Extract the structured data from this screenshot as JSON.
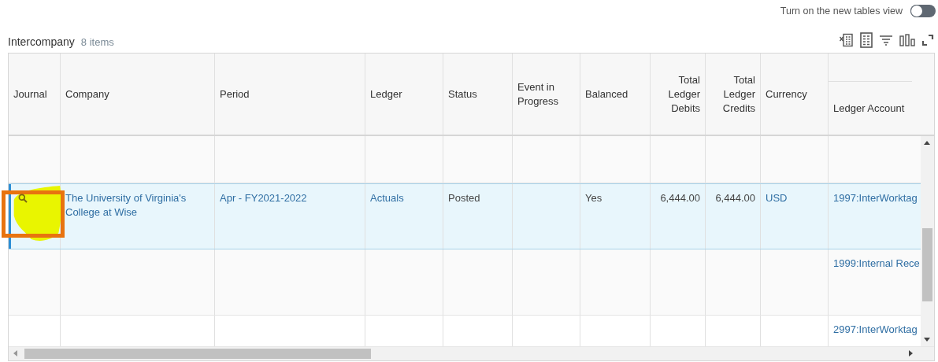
{
  "toggle": {
    "label": "Turn on the new tables view",
    "on": false
  },
  "grid": {
    "title": "Intercompany",
    "count": "8 items",
    "columns": [
      {
        "label": "Journal",
        "numeric": false
      },
      {
        "label": "Company",
        "numeric": false
      },
      {
        "label": "Period",
        "numeric": false
      },
      {
        "label": "Ledger",
        "numeric": false
      },
      {
        "label": "Status",
        "numeric": false
      },
      {
        "label": "Event in Progress",
        "numeric": false
      },
      {
        "label": "Balanced",
        "numeric": false
      },
      {
        "label": "Total Ledger Debits",
        "numeric": true
      },
      {
        "label": "Total Ledger Credits",
        "numeric": true
      },
      {
        "label": "Currency",
        "numeric": false
      },
      {
        "label": "Ledger Account",
        "numeric": false
      }
    ],
    "rows": [
      {
        "selected": false,
        "journal_link": false
      },
      {
        "selected": true,
        "journal_link": true,
        "company": "The University of Virginia's College at Wise",
        "period": "Apr - FY2021-2022",
        "ledger": "Actuals",
        "status": "Posted",
        "balanced": "Yes",
        "debits": "6,444.00",
        "credits": "6,444.00",
        "currency": "USD",
        "ledger_account": "1997:InterWorktag"
      },
      {
        "selected": false,
        "journal_link": false,
        "ledger_account": "1999:Internal Rece"
      },
      {
        "selected": false,
        "journal_link": false,
        "ledger_account": "2997:InterWorktag"
      }
    ]
  },
  "annotations": {
    "highlight": true,
    "frame": true
  }
}
